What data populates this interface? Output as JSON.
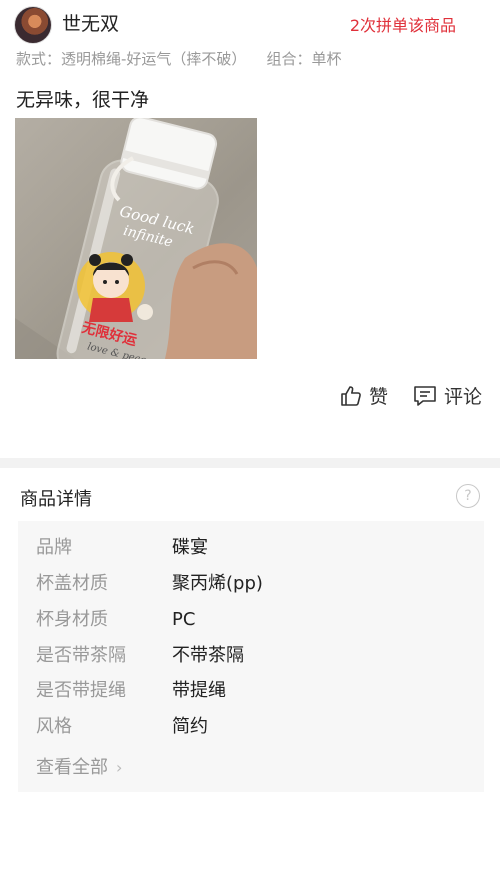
{
  "review": {
    "username": "世无双",
    "group_count": "2次拼单该商品",
    "spec_style_label": "款式：",
    "spec_style_value": "透明棉绳-好运气（摔不破）",
    "spec_combo_label": "组合：",
    "spec_combo_value": "单杯",
    "text": "无异味，很干净",
    "photo_texts": {
      "good_luck": "Good luck",
      "infinite": "infinite",
      "wuxian_haoyun": "无限好运",
      "love_peace": "love & peace"
    },
    "like_label": "赞",
    "comment_label": "评论"
  },
  "details": {
    "title": "商品详情",
    "help_icon": "?",
    "rows": [
      {
        "key": "品牌",
        "value": "碟宴"
      },
      {
        "key": "杯盖材质",
        "value": "聚丙烯(pp)"
      },
      {
        "key": "杯身材质",
        "value": "PC"
      },
      {
        "key": "是否带茶隔",
        "value": "不带茶隔"
      },
      {
        "key": "是否带提绳",
        "value": "带提绳"
      },
      {
        "key": "风格",
        "value": "简约"
      }
    ],
    "view_all": "查看全部",
    "view_all_chevron": "›"
  },
  "colors": {
    "accent_red": "#e0303a",
    "muted_text": "#999999",
    "divider": "#f2f2f2"
  }
}
